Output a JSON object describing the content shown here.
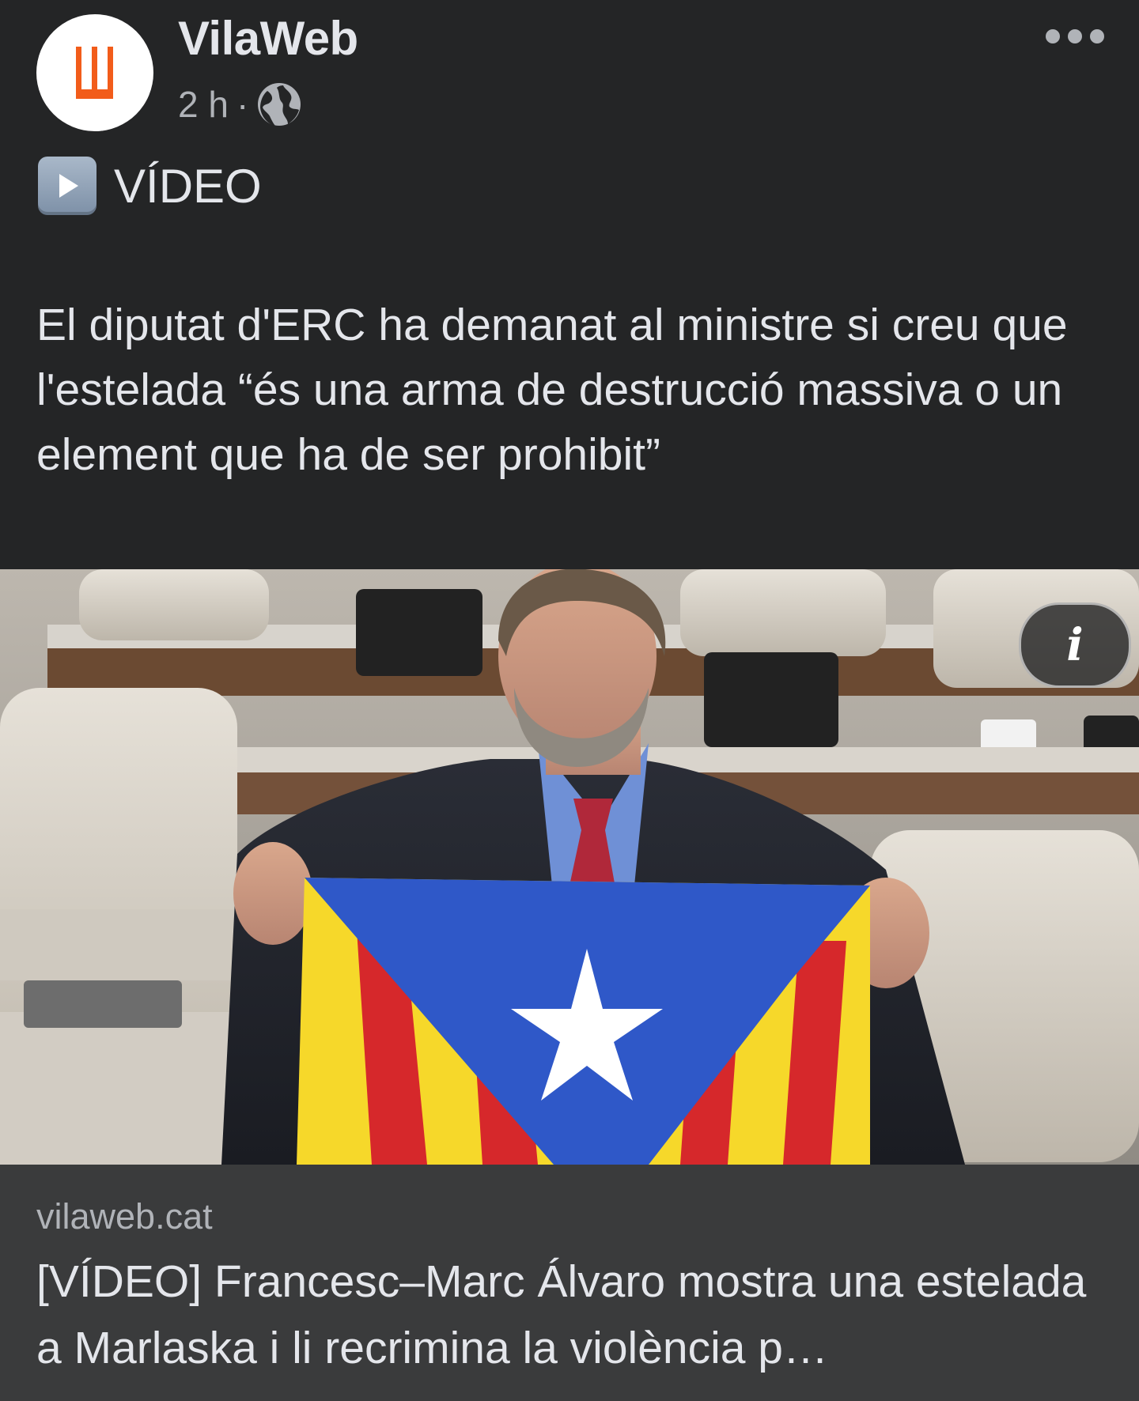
{
  "header": {
    "page_name": "VilaWeb",
    "timestamp": "2 h",
    "separator": "·",
    "privacy_icon": "globe-icon",
    "more_icon": "more-options-icon"
  },
  "post": {
    "video_tag": "VÍDEO",
    "video_tag_icon": "play-button-icon",
    "text": "El diputat d'ERC ha demanat al ministre si creu que l'estelada “és una arma de destrucció massiva o un element que ha de ser prohibit”"
  },
  "media": {
    "info_button_label": "i"
  },
  "link_preview": {
    "domain": "vilaweb.cat",
    "title": "[VÍDEO] Francesc–Marc Álvaro mostra una estelada a Marlaska i li recrimina la violència p…"
  },
  "colors": {
    "background": "#242526",
    "card": "#3a3b3c",
    "text_primary": "#e4e6eb",
    "text_secondary": "#b0b3b8",
    "brand_orange": "#f25c1a",
    "flag_blue": "#2f58c8",
    "flag_yellow": "#f6d82a",
    "flag_red": "#d6282b"
  }
}
